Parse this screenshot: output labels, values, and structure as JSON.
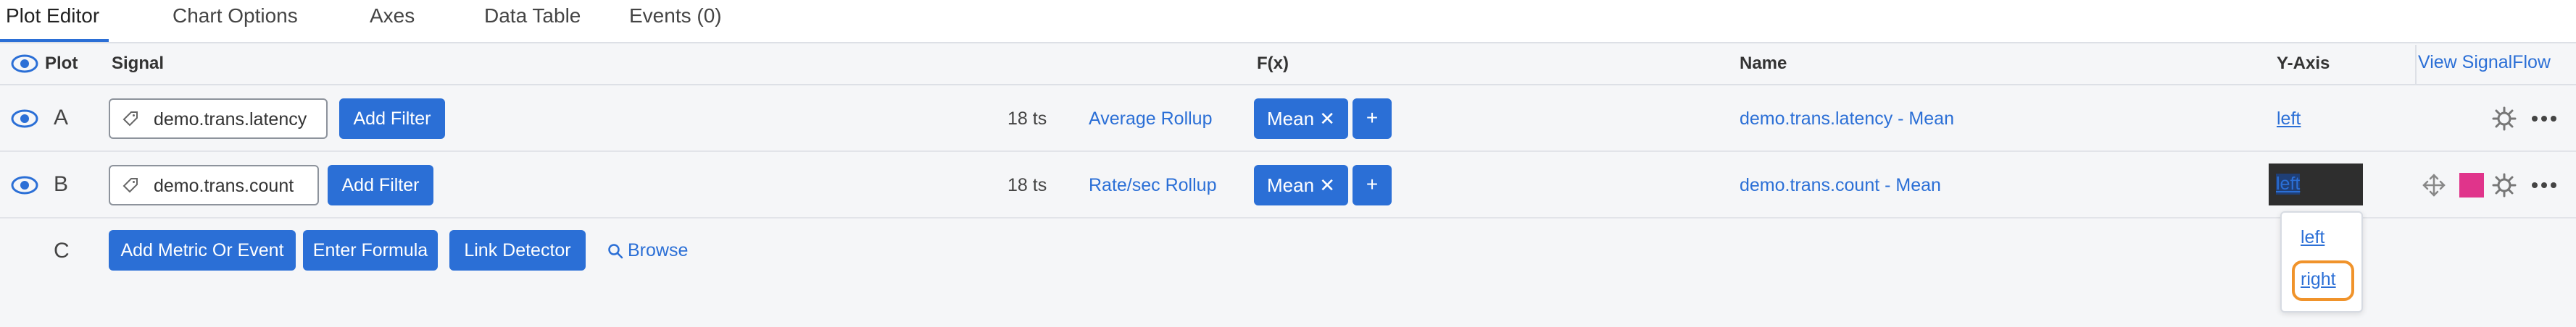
{
  "tabs": [
    {
      "label": "Plot Editor"
    },
    {
      "label": "Chart Options"
    },
    {
      "label": "Axes"
    },
    {
      "label": "Data Table"
    },
    {
      "label": "Events (0)"
    }
  ],
  "header": {
    "plot": "Plot",
    "signal": "Signal",
    "fx": "F(x)",
    "name": "Name",
    "yaxis": "Y-Axis",
    "view_signalflow": "View SignalFlow"
  },
  "rows": [
    {
      "letter": "A",
      "signal": "demo.trans.latency",
      "add_filter": "Add Filter",
      "ts": "18 ts",
      "rollup": "Average Rollup",
      "fx_mean": "Mean ✕",
      "fx_plus": "+",
      "name": "demo.trans.latency - Mean",
      "yaxis": "left"
    },
    {
      "letter": "B",
      "signal": "demo.trans.count",
      "add_filter": "Add Filter",
      "ts": "18 ts",
      "rollup": "Rate/sec Rollup",
      "fx_mean": "Mean ✕",
      "fx_plus": "+",
      "name": "demo.trans.count - Mean",
      "yaxis": "left",
      "color": "#e0348b"
    }
  ],
  "row_c": {
    "letter": "C",
    "add_metric": "Add Metric Or Event",
    "enter_formula": "Enter Formula",
    "link_detector": "Link Detector",
    "browse": "Browse"
  },
  "yaxis_dropdown": {
    "options": [
      "left",
      "right"
    ],
    "highlighted": "right"
  },
  "icons": [
    "eye-icon",
    "tag-icon",
    "gear-icon",
    "more-icon",
    "move-icon",
    "search-icon"
  ],
  "colors": {
    "accent": "#2b6fd6",
    "highlight": "#f0932b"
  }
}
